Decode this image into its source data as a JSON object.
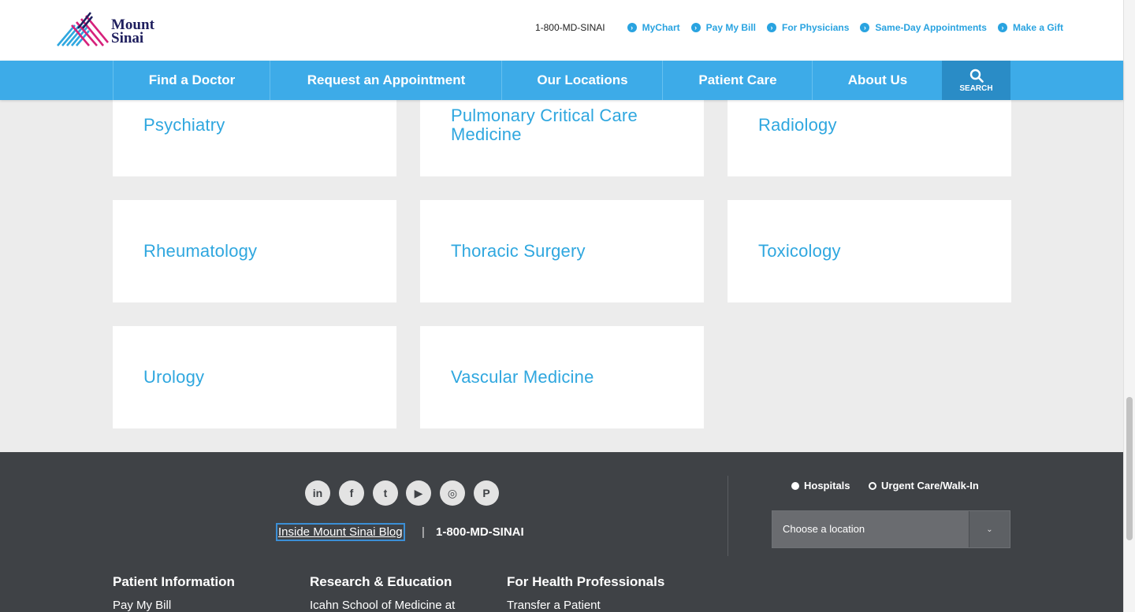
{
  "header": {
    "logo_line1": "Mount",
    "logo_line2": "Sinai",
    "phone": "1-800-MD-SINAI",
    "links": [
      "MyChart",
      "Pay My Bill",
      "For Physicians",
      "Same-Day Appointments",
      "Make a Gift"
    ]
  },
  "nav": {
    "items": [
      "Find a Doctor",
      "Request an Appointment",
      "Our Locations",
      "Patient Care",
      "About Us"
    ],
    "search_label": "SEARCH"
  },
  "cards": [
    "Psychiatry",
    "Pulmonary Critical Care Medicine",
    "Radiology",
    "Rheumatology",
    "Thoracic Surgery",
    "Toxicology",
    "Urology",
    "Vascular Medicine"
  ],
  "footer": {
    "social": [
      {
        "icon": "linkedin-icon",
        "glyph": "in"
      },
      {
        "icon": "facebook-icon",
        "glyph": "f"
      },
      {
        "icon": "twitter-icon",
        "glyph": "t"
      },
      {
        "icon": "youtube-icon",
        "glyph": "▶"
      },
      {
        "icon": "instagram-icon",
        "glyph": "◎"
      },
      {
        "icon": "pinterest-icon",
        "glyph": "P"
      }
    ],
    "blog_link": "Inside Mount Sinai Blog",
    "separator": "|",
    "phone": "1-800-MD-SINAI",
    "radio_hospitals": "Hospitals",
    "radio_urgent": "Urgent Care/Walk-In",
    "location_placeholder": "Choose a location",
    "columns": [
      {
        "title": "Patient Information",
        "first_link": "Pay My Bill"
      },
      {
        "title": "Research & Education",
        "first_link": "Icahn School of Medicine at"
      },
      {
        "title": "For Health Professionals",
        "first_link": "Transfer a Patient"
      }
    ]
  },
  "colors": {
    "brand_blue": "#3dabe8",
    "link_blue": "#29a3e0",
    "card_text": "#2fa7df",
    "footer_bg": "#3f4246"
  }
}
